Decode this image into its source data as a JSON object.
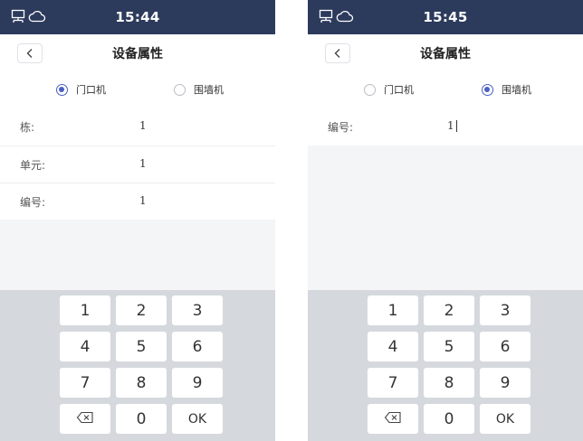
{
  "screens": [
    {
      "status": {
        "time": "15:44"
      },
      "header": {
        "title": "设备属性"
      },
      "radio": {
        "option1": "门口机",
        "option2": "围墙机",
        "selected": "门口机"
      },
      "fields": [
        {
          "label": "栋:",
          "value": "1"
        },
        {
          "label": "单元:",
          "value": "1"
        },
        {
          "label": "编号:",
          "value": "1"
        }
      ]
    },
    {
      "status": {
        "time": "15:45"
      },
      "header": {
        "title": "设备属性"
      },
      "radio": {
        "option1": "门口机",
        "option2": "围墙机",
        "selected": "围墙机"
      },
      "fields": [
        {
          "label": "编号:",
          "value": "1"
        }
      ]
    }
  ],
  "keypad": {
    "keys": [
      "1",
      "2",
      "3",
      "4",
      "5",
      "6",
      "7",
      "8",
      "9",
      "⌫",
      "0",
      "OK"
    ]
  },
  "icons": {
    "statusbar_left": "lan-icon",
    "statusbar_right": "cloud-icon",
    "back": "chevron-left-icon",
    "backspace": "backspace-icon"
  },
  "colors": {
    "statusbar": "#2c3a5c",
    "accent": "#4a5fc1",
    "keypad_bg": "#d5d9de",
    "page_bg": "#f4f5f7"
  }
}
